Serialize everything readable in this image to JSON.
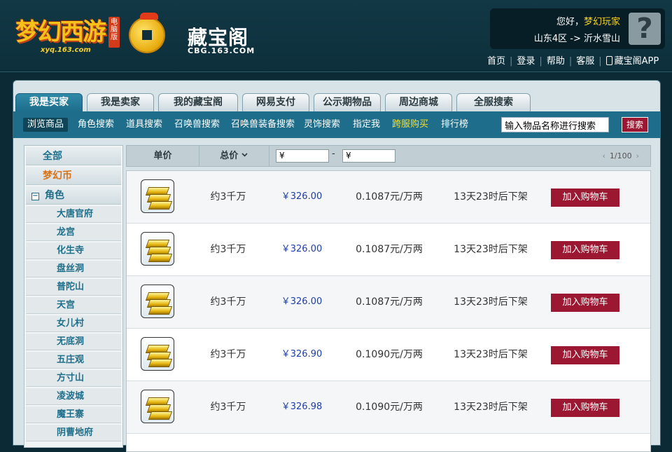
{
  "header": {
    "logo_game_text": "梦幻西游",
    "logo_game_badge": "电脑版",
    "logo_game_url": "xyq.163.com",
    "logo_cbg_text": "藏宝阁",
    "logo_cbg_url": "CBG.163.COM",
    "greeting_prefix": "您好，",
    "username": "梦幻玩家",
    "server": "山东4区 -> 沂水雪山",
    "avatar_glyph": "?",
    "links": [
      {
        "label": "首页"
      },
      {
        "label": "登录"
      },
      {
        "label": "帮助"
      },
      {
        "label": "客服"
      },
      {
        "label": "藏宝阁APP",
        "icon": "phone-icon"
      }
    ]
  },
  "tabs": [
    {
      "label": "我是买家",
      "active": true
    },
    {
      "label": "我是卖家"
    },
    {
      "label": "我的藏宝阁"
    },
    {
      "label": "网易支付"
    },
    {
      "label": "公示期物品"
    },
    {
      "label": "周边商城"
    },
    {
      "label": "全服搜索"
    }
  ],
  "subnav": {
    "items": [
      {
        "label": "浏览商品",
        "active": true
      },
      {
        "label": "角色搜索"
      },
      {
        "label": "道具搜索"
      },
      {
        "label": "召唤兽搜索"
      },
      {
        "label": "召唤兽装备搜索"
      },
      {
        "label": "灵饰搜索"
      },
      {
        "label": "指定我"
      },
      {
        "label": "跨服购买",
        "highlight": true
      },
      {
        "label": "排行榜"
      }
    ],
    "search_placeholder": "输入物品名称进行搜索",
    "search_button": "搜索"
  },
  "sidebar": {
    "all": "全部",
    "currency": "梦幻币",
    "role_group": "角色",
    "role_toggle": "−",
    "roles": [
      "大唐官府",
      "龙宫",
      "化生寺",
      "盘丝洞",
      "普陀山",
      "天宫",
      "女儿村",
      "无底洞",
      "五庄观",
      "方寸山",
      "凌波城",
      "魔王寨",
      "阴曹地府"
    ]
  },
  "list_header": {
    "unit_price": "单价",
    "total_price": "总价",
    "sort_icon": "chevron-down-icon",
    "min_price_prefix": "¥",
    "max_price_prefix": "¥",
    "range_dash": "-",
    "page_indicator": "1/100"
  },
  "listings": [
    {
      "amount": "约3千万",
      "price": "￥326.00",
      "rate": "0.1087元/万两",
      "expire": "13天23时后下架",
      "action": "加入购物车"
    },
    {
      "amount": "约3千万",
      "price": "￥326.00",
      "rate": "0.1087元/万两",
      "expire": "13天23时后下架",
      "action": "加入购物车"
    },
    {
      "amount": "约3千万",
      "price": "￥326.00",
      "rate": "0.1087元/万两",
      "expire": "13天23时后下架",
      "action": "加入购物车"
    },
    {
      "amount": "约3千万",
      "price": "￥326.90",
      "rate": "0.1090元/万两",
      "expire": "13天23时后下架",
      "action": "加入购物车"
    },
    {
      "amount": "约3千万",
      "price": "￥326.98",
      "rate": "0.1090元/万两",
      "expire": "13天23时后下架",
      "action": "加入购物车"
    }
  ],
  "colors": {
    "accent": "#1e6e8b",
    "button": "#9c1832",
    "highlight_text": "#f6e02a",
    "price_text": "#1f3fa8",
    "currency_text": "#d7731a"
  }
}
